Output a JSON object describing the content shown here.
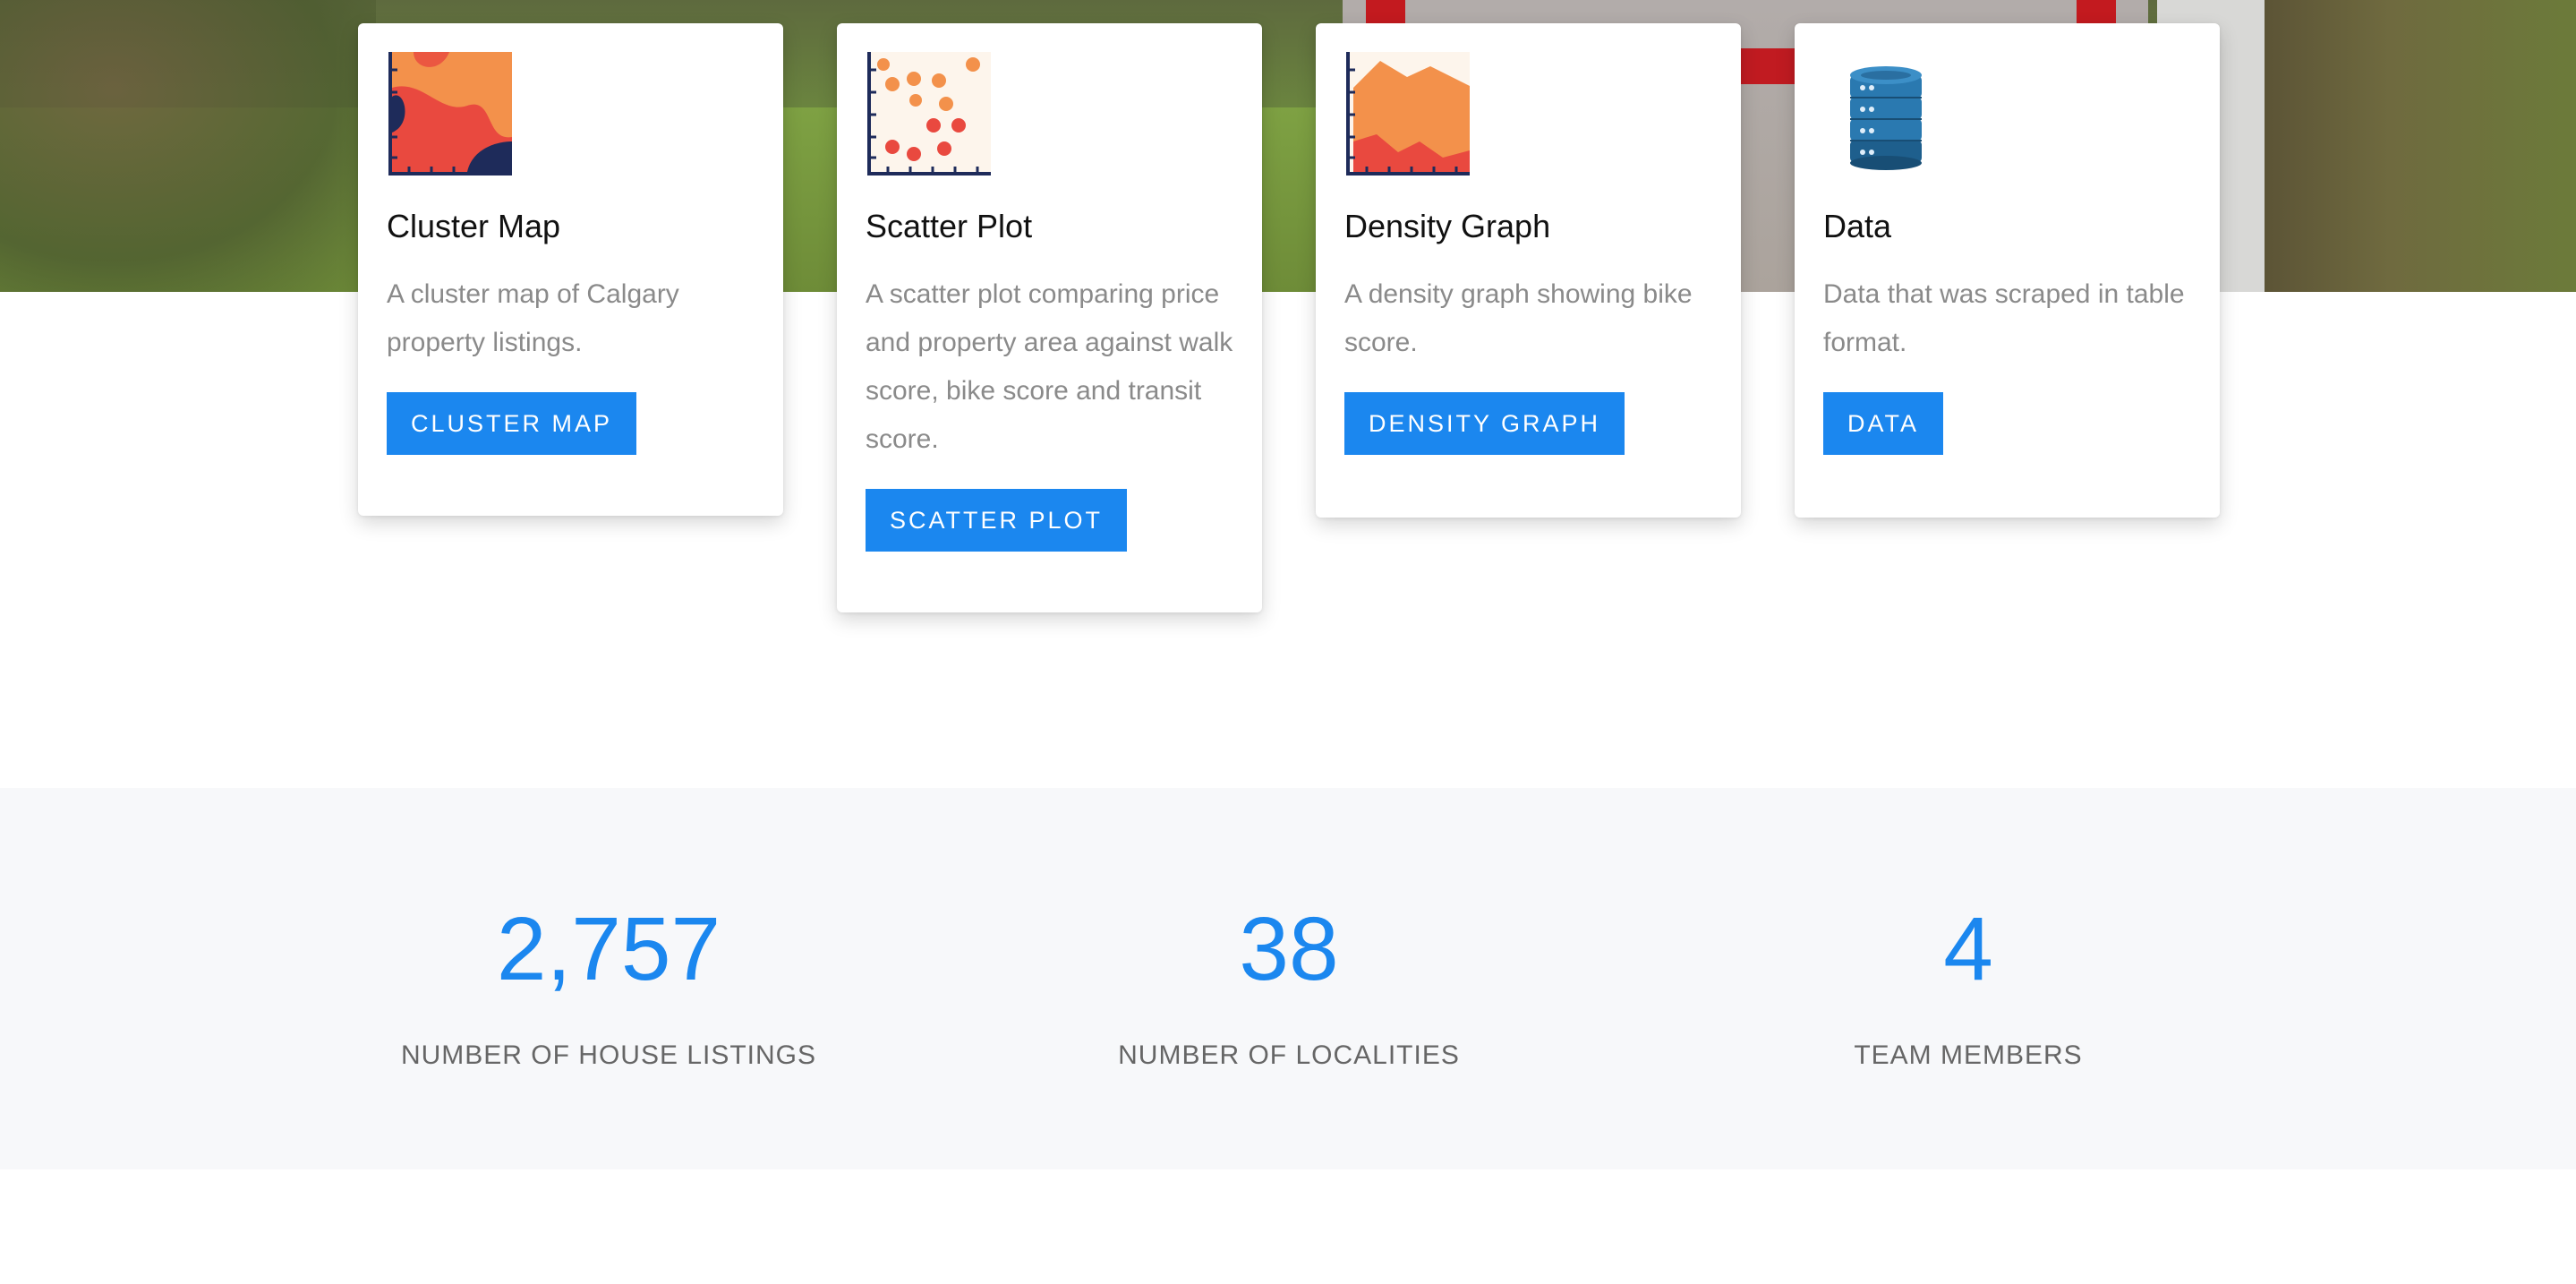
{
  "cards": [
    {
      "title": "Cluster Map",
      "text": "A cluster map of Calgary property listings.",
      "button": "CLUSTER MAP",
      "icon": "cluster-map-icon"
    },
    {
      "title": "Scatter Plot",
      "text": "A scatter plot comparing price and property area against walk score, bike score and transit score.",
      "button": "SCATTER PLOT",
      "icon": "scatter-plot-icon"
    },
    {
      "title": "Density Graph",
      "text": "A density graph showing bike score.",
      "button": "DENSITY GRAPH",
      "icon": "density-graph-icon"
    },
    {
      "title": "Data",
      "text": "Data that was scraped in table format.",
      "button": "DATA",
      "icon": "database-icon"
    }
  ],
  "stats": [
    {
      "value": "2,757",
      "label": "NUMBER OF HOUSE LISTINGS"
    },
    {
      "value": "38",
      "label": "NUMBER OF LOCALITIES"
    },
    {
      "value": "4",
      "label": "TEAM MEMBERS"
    }
  ],
  "colors": {
    "accent": "#1b87ef",
    "stats_bg": "#f7f8fa",
    "muted_text": "#8a8a8a"
  }
}
